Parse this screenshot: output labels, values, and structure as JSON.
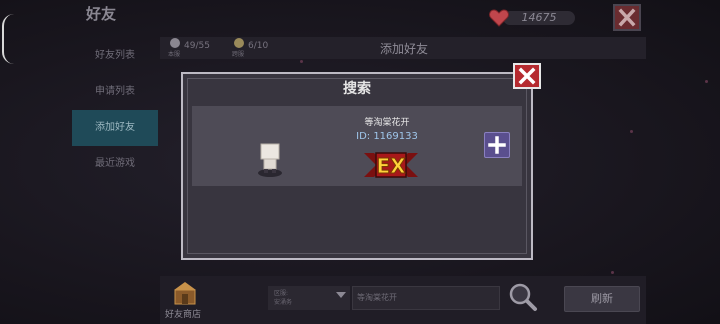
{
  "header": {
    "title": "好友",
    "coins": "14675",
    "icons": {
      "currency": "heart-icon",
      "close": "close-icon"
    }
  },
  "sidebar": {
    "items": [
      {
        "label": "好友列表",
        "active": false
      },
      {
        "label": "申请列表",
        "active": false
      },
      {
        "label": "添加好友",
        "active": true
      },
      {
        "label": "最近游戏",
        "active": false
      }
    ]
  },
  "top_bar": {
    "friends_count": "49/55",
    "friends_caption": "本服",
    "other_count": "6/10",
    "other_caption": "跨服",
    "tab_label": "添加好友"
  },
  "modal": {
    "title": "搜索",
    "player": {
      "name": "等淘棠花开",
      "id": "ID: 1169133",
      "badge": "EX"
    }
  },
  "bottom_bar": {
    "shop_label": "好友商店",
    "region_label": "区服:",
    "region_value": "安涌务",
    "name_value": "等淘棠花开",
    "refresh_label": "刷新"
  },
  "colors": {
    "accent_active": "#1f4a58",
    "close_red": "#b52a2f",
    "add_purple": "#5a4f8e",
    "id_blue": "#9fc6ea"
  }
}
